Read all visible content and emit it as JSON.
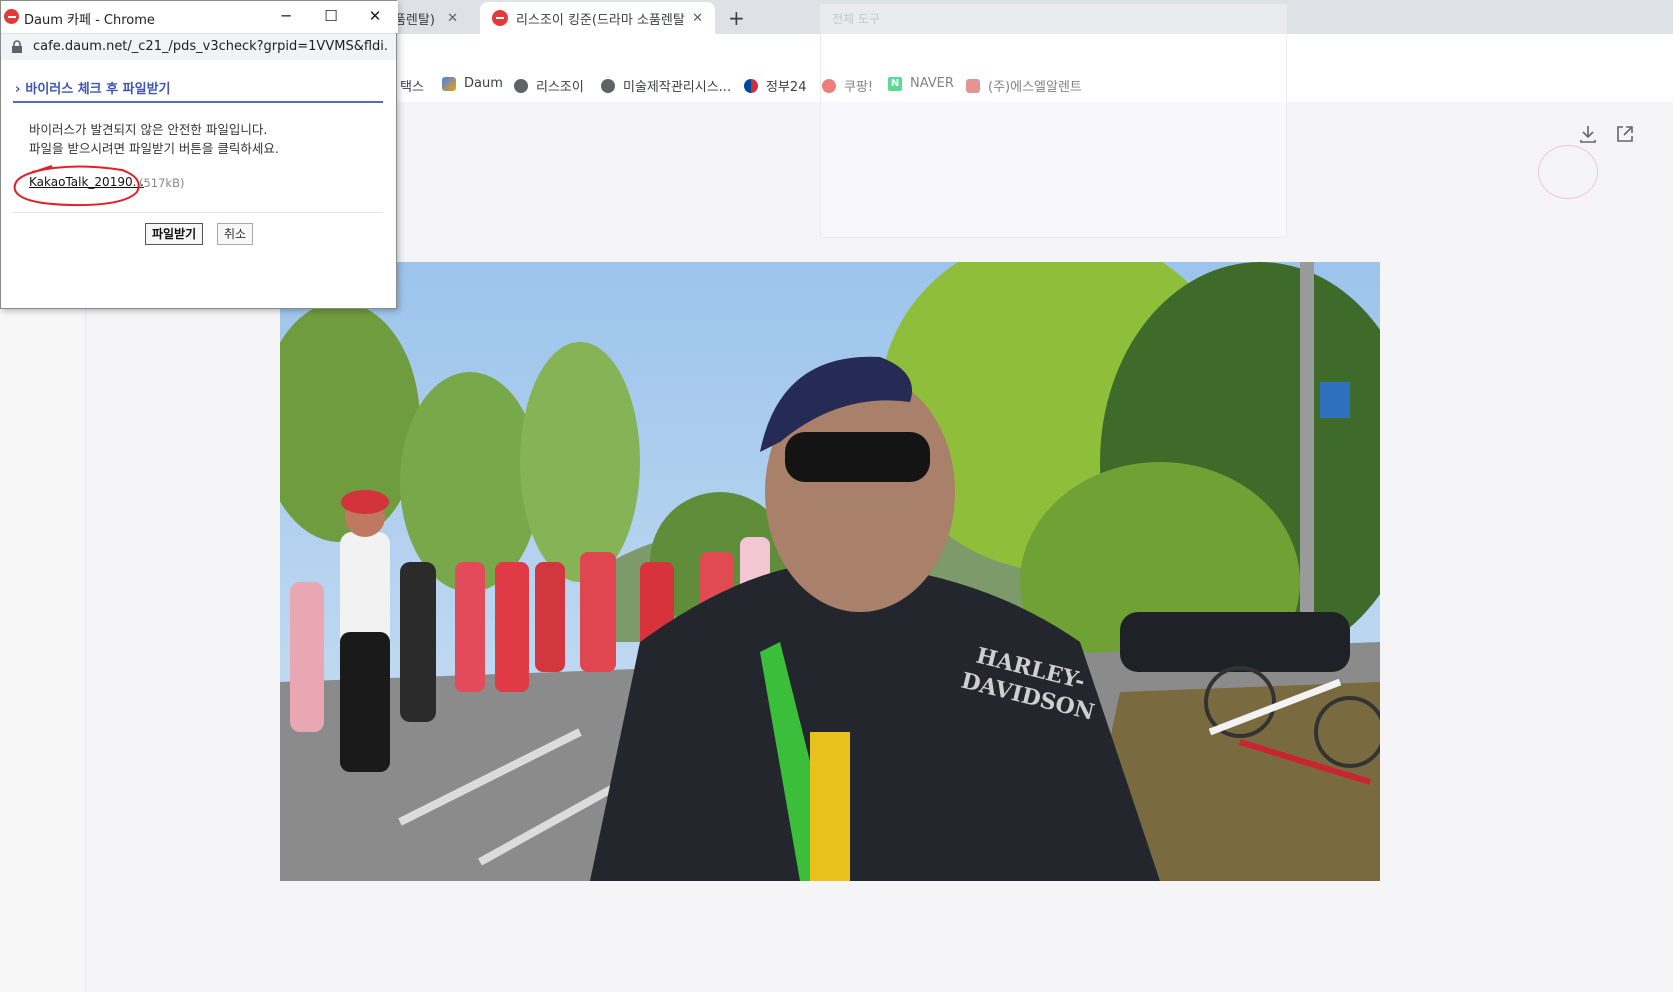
{
  "browser": {
    "tabs": [
      {
        "title": "소품렌탈)",
        "active": false
      },
      {
        "title": "리스조이 킹준(드라마 소품렌탈)",
        "active": true
      }
    ],
    "new_tab_symbol": "+",
    "bookmarks": [
      {
        "label": "택스",
        "icon": "bookmark-icon"
      },
      {
        "label": "Daum",
        "icon": "daum-icon"
      },
      {
        "label": "리스조이",
        "icon": "globe-icon"
      },
      {
        "label": "미술제작관리시스...",
        "icon": "globe-icon"
      },
      {
        "label": "정부24",
        "icon": "gov24-icon"
      },
      {
        "label": "쿠팡!",
        "icon": "coupang-icon"
      },
      {
        "label": "NAVER",
        "icon": "naver-icon"
      },
      {
        "label": "(주)에스엘알렌트",
        "icon": "camera-icon"
      }
    ]
  },
  "page": {
    "ghost_label": "전체 도구"
  },
  "popup": {
    "window_title": "Daum 카페 - Chrome",
    "url": "cafe.daum.net/_c21_/pds_v3check?grpid=1VVMS&fldi...",
    "heading": "바이러스 체크 후 파일받기",
    "message_line1": "바이러스가 발견되지 않은 안전한 파일입니다.",
    "message_line2": "파일을 받으시려면 파일받기 버튼을 클릭하세요.",
    "file_name": "KakaoTalk_20190...",
    "file_size": "(517kB)",
    "download_label": "파일받기",
    "cancel_label": "취소"
  },
  "colors": {
    "accent_blue": "#3d55b8",
    "daum_red": "#e03a3a",
    "annotation_red": "#e0202a"
  }
}
